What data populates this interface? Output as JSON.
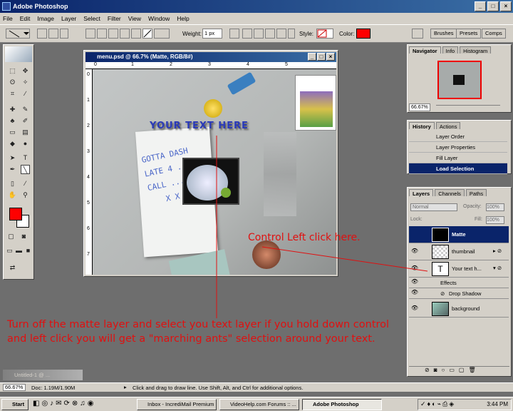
{
  "app": {
    "title": "Adobe Photoshop"
  },
  "menu": [
    "File",
    "Edit",
    "Image",
    "Layer",
    "Select",
    "Filter",
    "View",
    "Window",
    "Help"
  ],
  "options": {
    "weight_label": "Weight:",
    "weight_value": "1 px",
    "style_label": "Style:",
    "color_label": "Color:",
    "color_value": "#ff0000"
  },
  "palette_well": [
    "Brushes",
    "Presets",
    "Comps"
  ],
  "document": {
    "title": "menu.psd @ 66.7% (Matte, RGB/8#)",
    "ruler_h": [
      "0",
      "1",
      "2",
      "3",
      "4",
      "5"
    ],
    "ruler_v": [
      "0",
      "1",
      "2",
      "3",
      "4",
      "5",
      "6",
      "7"
    ],
    "overlay_text": "YOUR TEXT HERE",
    "note_lines": [
      "GOTTA DASH",
      "LATE 4 ..",
      "CALL ...",
      "X X"
    ]
  },
  "navigator": {
    "tabs": [
      "Navigator",
      "Info",
      "Histogram"
    ],
    "zoom": "66.67%"
  },
  "history": {
    "tabs": [
      "History",
      "Actions"
    ],
    "items": [
      "Layer Order",
      "Layer Properties",
      "Fill Layer",
      "Load Selection"
    ],
    "selected": "Load Selection"
  },
  "layers": {
    "tabs": [
      "Layers",
      "Channels",
      "Paths"
    ],
    "blend_mode": "Normal",
    "opacity_label": "Opacity:",
    "opacity_value": "100%",
    "lock_label": "Lock:",
    "fill_label": "Fill:",
    "fill_value": "100%",
    "items": [
      {
        "name": "Matte",
        "selected": true
      },
      {
        "name": "thumbnail"
      },
      {
        "name": "Your text h..."
      },
      {
        "name": "Effects"
      },
      {
        "name": "Drop Shadow"
      },
      {
        "name": "background"
      }
    ]
  },
  "minimized_doc": {
    "title": "Untitled-1 @ ..."
  },
  "status": {
    "zoom": "66.67%",
    "doc": "Doc: 1.19M/1.90M",
    "hint": "Click and drag to draw line. Use Shift, Alt, and Ctrl for additional options."
  },
  "annotations": {
    "ctrl_label": "Control Left click here.",
    "instruction_line1": "Turn off the matte layer and select you text layer if you hold down control",
    "instruction_line2": "and left click you will get a \"marching ants\" selection around your text."
  },
  "taskbar": {
    "start": "Start",
    "tasks": [
      "Inbox - IncrediMail Premium",
      "VideoHelp.com Forums :: ...",
      "Adobe Photoshop"
    ],
    "clock": "3:44 PM"
  },
  "colors": {
    "foreground": "#ff0000",
    "background": "#ffffff",
    "annotation": "#e01010",
    "title_bar": "#0a246a"
  }
}
